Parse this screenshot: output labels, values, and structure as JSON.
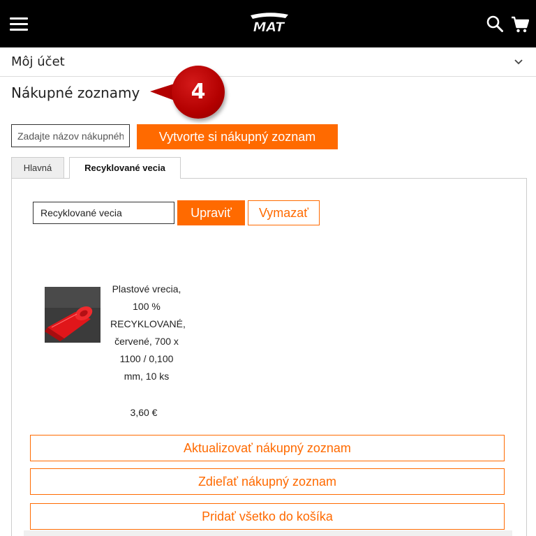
{
  "header": {
    "brand": "MAT",
    "menu_icon": "hamburger-menu-icon",
    "search_icon": "search-icon",
    "cart_icon": "shopping-cart-icon",
    "background": "#000000"
  },
  "account": {
    "label": "Môj účet",
    "toggle_icon": "chevron-down-icon"
  },
  "page": {
    "title": "Nákupné zoznamy"
  },
  "callout": {
    "number": "4",
    "color": "#b30000"
  },
  "create_list": {
    "input_placeholder": "Zadajte názov nákupného zoznamu",
    "input_value": "",
    "button_label": "Vytvorte si nákupný zoznam"
  },
  "tabs": [
    {
      "label": "Hlavná",
      "active": false
    },
    {
      "label": "Recyklované vecia",
      "active": true
    }
  ],
  "list_editor": {
    "name_value": "Recyklované vecia",
    "edit_label": "Upraviť",
    "delete_label": "Vymazať"
  },
  "product": {
    "image_icon": "red-plastic-bags-roll-image",
    "name": "Plastové vrecia, 100 % RECYKLOVANÉ, červené, 700 x 1100 / 0,100 mm, 10 ks",
    "price": "3,60 €"
  },
  "actions": {
    "update_label": "Aktualizovať nákupný zoznam",
    "share_label": "Zdieľať nákupný zoznam",
    "add_all_label": "Pridať všetko do košíka"
  },
  "colors": {
    "accent": "#ff6a00",
    "header": "#000000",
    "callout": "#b30000"
  }
}
